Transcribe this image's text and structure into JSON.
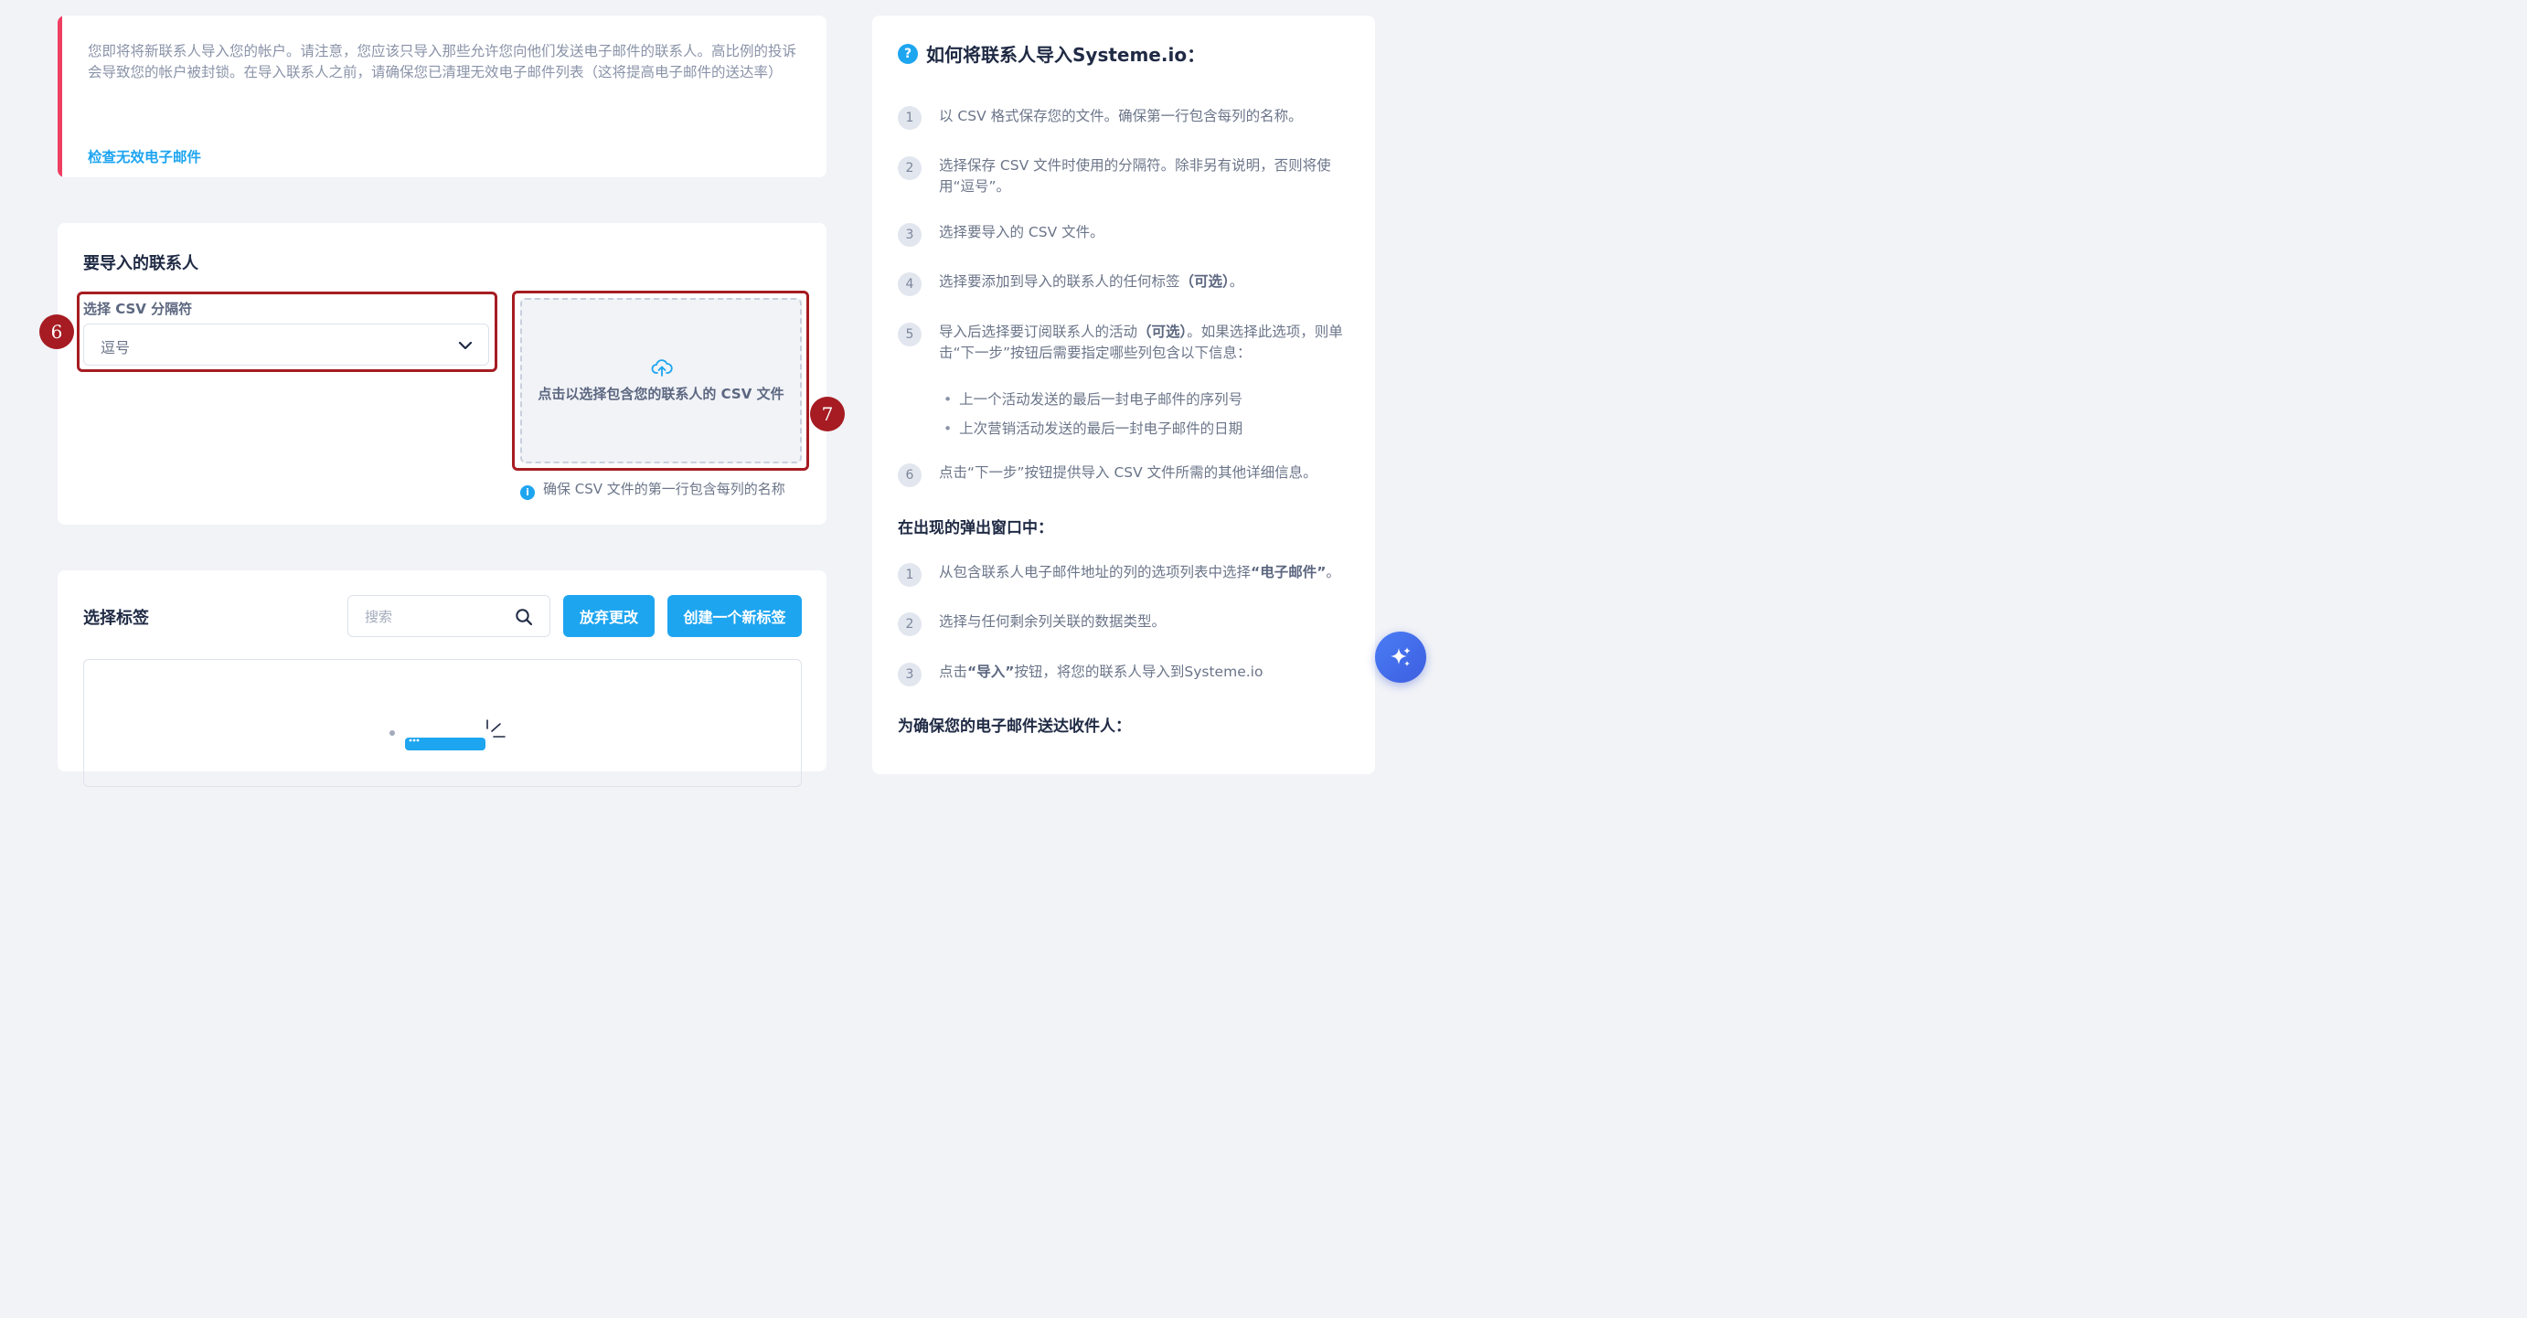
{
  "warning": {
    "text": "您即将将新联系人导入您的帐户。请注意，您应该只导入那些允许您向他们发送电子邮件的联系人。高比例的投诉会导致您的帐户被封锁。在导入联系人之前，请确保您已清理无效电子邮件列表（这将提高电子邮件的送达率）",
    "link": "检查无效电子邮件",
    "accent_color": "#ef3e62"
  },
  "contacts": {
    "title": "要导入的联系人",
    "separator_label": "选择 CSV 分隔符",
    "separator_value": "逗号",
    "dropzone_text": "点击以选择包含您的联系人的 CSV 文件",
    "note": "确保 CSV 文件的第一行包含每列的名称",
    "dropzone_icon": "cloud-upload-icon"
  },
  "markers": {
    "m6": "6",
    "m7": "7",
    "color": "#a61c22"
  },
  "tags": {
    "title": "选择标签",
    "search_placeholder": "搜索",
    "discard_label": "放弃更改",
    "create_label": "创建一个新标签"
  },
  "help": {
    "title": "如何将联系人导入Systeme.io：",
    "steps": [
      {
        "n": "1",
        "text": "以 CSV 格式保存您的文件。确保第一行包含每列的名称。"
      },
      {
        "n": "2",
        "text": "选择保存 CSV 文件时使用的分隔符。除非另有说明，否则将使用“逗号”。"
      },
      {
        "n": "3",
        "text": "选择要导入的 CSV 文件。"
      },
      {
        "n": "4",
        "pre": "选择要添加到导入的联系人的任何标签",
        "bold": "（可选）",
        "post": "。"
      },
      {
        "n": "5",
        "pre": "导入后选择要订阅联系人的活动",
        "bold": "（可选）",
        "post": "。如果选择此选项，则单击“下一步”按钮后需要指定哪些列包含以下信息："
      },
      {
        "n": "6",
        "text": "点击“下一步”按钮提供导入 CSV 文件所需的其他详细信息。"
      }
    ],
    "bullets": [
      "上一个活动发送的最后一封电子邮件的序列号",
      "上次营销活动发送的最后一封电子邮件的日期"
    ],
    "popup_heading": "在出现的弹出窗口中：",
    "popup_steps": [
      {
        "n": "1",
        "pre": "从包含联系人电子邮件地址的列的选项列表中选择",
        "bold": "“电子邮件”",
        "post": "。"
      },
      {
        "n": "2",
        "text": "选择与任何剩余列关联的数据类型。"
      },
      {
        "n": "3",
        "pre": "点击",
        "bold": "“导入”",
        "post": "按钮，将您的联系人导入到Systeme.io"
      }
    ],
    "deliver_heading": "为确保您的电子邮件送达收件人："
  },
  "fab_icon": "sparkle-icon",
  "brand_color": "#1ea5f0"
}
